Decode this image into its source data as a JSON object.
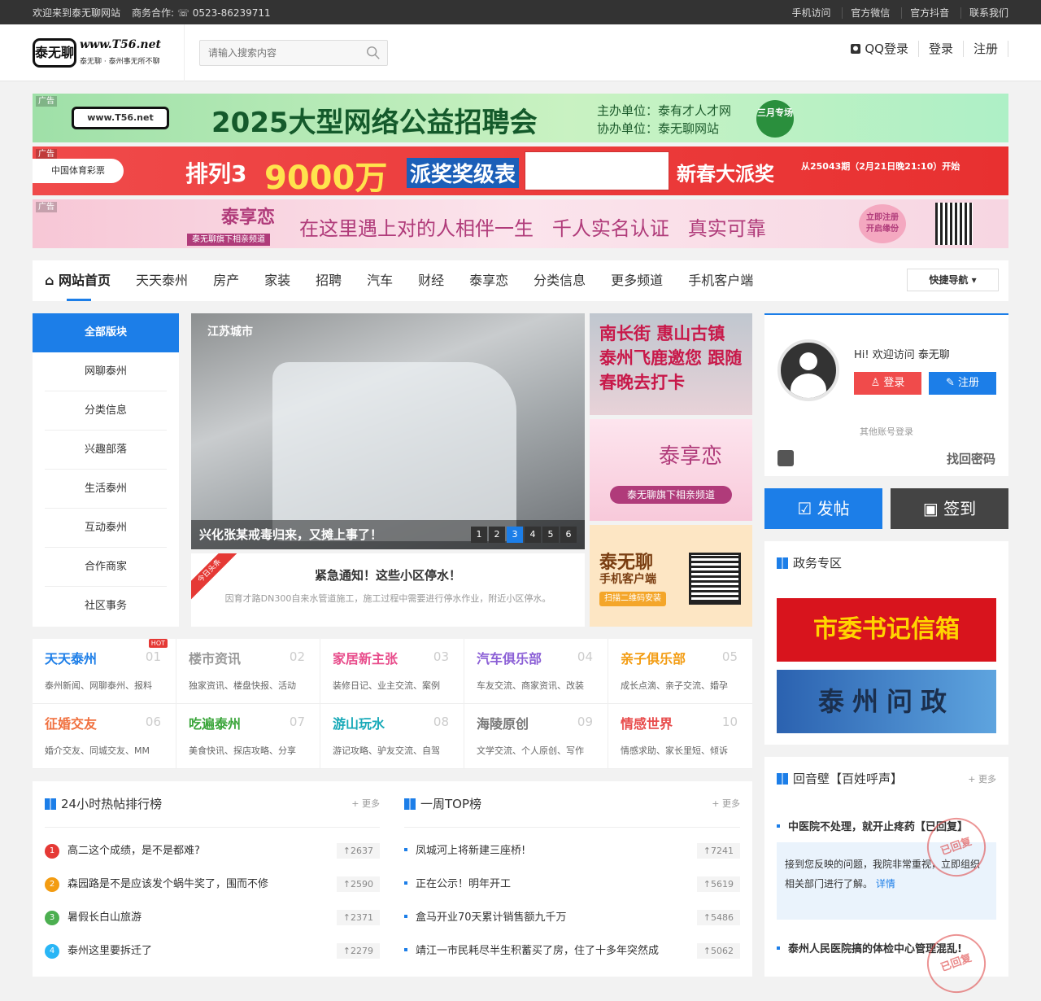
{
  "topbar": {
    "welcome": "欢迎来到泰无聊网站",
    "biz": "商务合作:",
    "phone": "0523-86239711",
    "links": [
      "手机访问",
      "官方微信",
      "官方抖音",
      "联系我们"
    ]
  },
  "logo": {
    "mark": "泰无聊",
    "url": "www.T56.net",
    "slogan": "泰无聊 · 泰州事无所不聊"
  },
  "search": {
    "placeholder": "请输入搜索内容"
  },
  "header": {
    "qq": "QQ登录",
    "login": "登录",
    "register": "注册"
  },
  "banners": {
    "ad": "广告",
    "b1_title": "2025大型网络公益招聘会",
    "b1_host": "主办单位：泰有才人才网",
    "b1_co": "协办单位：泰无聊网站",
    "b1_badge": "三月专场",
    "b2_brand": "中国体育彩票",
    "b2_game": "排列3",
    "b2_amount": "9000万",
    "b2_slogan": "派奖奖级表",
    "b2_right": "新春大派奖",
    "b2_note": "从25043期（2月21日晚21:10）开始",
    "b3_brand": "泰享恋",
    "b3_sub": "泰无聊旗下相亲频道",
    "b3_text": "在这里遇上对的人相伴一生   千人实名认证   真实可靠",
    "b3_btn": "立即注册开启缘份"
  },
  "nav": {
    "items": [
      "网站首页",
      "天天泰州",
      "房产",
      "家装",
      "招聘",
      "汽车",
      "财经",
      "泰享恋",
      "分类信息",
      "更多频道",
      "手机客户端"
    ],
    "quick": "快捷导航"
  },
  "side": {
    "head": "全部版块",
    "items": [
      "网聊泰州",
      "分类信息",
      "兴趣部落",
      "生活泰州",
      "互动泰州",
      "合作商家",
      "社区事务"
    ]
  },
  "slider": {
    "source": "江苏城市",
    "caption": "兴化张某戒毒归来，又摊上事了！",
    "pages": [
      "1",
      "2",
      "3",
      "4",
      "5",
      "6"
    ],
    "active": 2
  },
  "headline": {
    "ribbon": "今日头条",
    "title": "紧急通知！这些小区停水！",
    "desc": "因育才路DN300自来水管道施工，施工过程中需要进行停水作业，附近小区停水。"
  },
  "promos": {
    "p1": "南长街 惠山古镇 泰州飞鹿邀您 跟随春晚去打卡",
    "p2_title": "泰享恋",
    "p2_sub": "泰无聊旗下相亲频道",
    "p3_title": "泰无聊",
    "p3_sub": "手机客户端",
    "p3_btn": "扫描二维码安装"
  },
  "login": {
    "hi": "Hi! 欢迎访问 泰无聊",
    "login": "登录",
    "register": "注册",
    "other": "其他账号登录",
    "forgot": "找回密码"
  },
  "actions": {
    "post": "发帖",
    "sign": "签到"
  },
  "gov": {
    "title": "政务专区",
    "b1": "市委书记信箱",
    "b2": "泰州问政"
  },
  "cats": [
    {
      "name": "天天泰州",
      "no": "01",
      "desc": "泰州新闻、网聊泰州、报料",
      "color": "#1c7ee8",
      "hot": "HOT"
    },
    {
      "name": "楼市资讯",
      "no": "02",
      "desc": "独家资讯、楼盘快报、活动",
      "color": "#999"
    },
    {
      "name": "家居新主张",
      "no": "03",
      "desc": "装修日记、业主交流、案例",
      "color": "#e84c8b"
    },
    {
      "name": "汽车俱乐部",
      "no": "04",
      "desc": "车友交流、商家资讯、改装",
      "color": "#8b5fd6"
    },
    {
      "name": "亲子俱乐部",
      "no": "05",
      "desc": "成长点滴、亲子交流、婚孕",
      "color": "#f39c12"
    },
    {
      "name": "征婚交友",
      "no": "06",
      "desc": "婚介交友、同城交友、MM",
      "color": "#f0703f"
    },
    {
      "name": "吃遍泰州",
      "no": "07",
      "desc": "美食快讯、探店攻略、分享",
      "color": "#3aa53a"
    },
    {
      "name": "游山玩水",
      "no": "08",
      "desc": "游记攻略、驴友交流、自驾",
      "color": "#17a9b8"
    },
    {
      "name": "海陵原创",
      "no": "09",
      "desc": "文学交流、个人原创、写作",
      "color": "#777"
    },
    {
      "name": "情感世界",
      "no": "10",
      "desc": "情感求助、家长里短、倾诉",
      "color": "#e84c4c"
    }
  ],
  "hot24": {
    "title": "24小时热帖排行榜",
    "more": "+ 更多",
    "items": [
      {
        "rank": "1",
        "text": "高二这个成绩，是不是都难?",
        "count": "↑2637"
      },
      {
        "rank": "2",
        "text": "森园路是不是应该发个蜗牛奖了，围而不修",
        "count": "↑2590"
      },
      {
        "rank": "3",
        "text": "暑假长白山旅游",
        "count": "↑2371"
      },
      {
        "rank": "4",
        "text": "泰州这里要拆迁了",
        "count": "↑2279"
      }
    ]
  },
  "weekly": {
    "title": "一周TOP榜",
    "more": "+ 更多",
    "items": [
      {
        "text": "凤城河上将新建三座桥!",
        "count": "↑7241"
      },
      {
        "text": "正在公示！明年开工",
        "count": "↑5619"
      },
      {
        "text": "盒马开业70天累计销售额九千万",
        "count": "↑5486"
      },
      {
        "text": "靖江一市民耗尽半生积蓄买了房，住了十多年突然成",
        "count": "↑5062"
      }
    ]
  },
  "echo": {
    "title": "回音壁【百姓呼声】",
    "more": "+ 更多",
    "q1": "中医院不处理，就开止疼药【已回复】",
    "a1": "接到您反映的问题，我院非常重视，立即组织相关部门进行了解。",
    "detail": "详情",
    "stamp": "已回复",
    "q2": "泰州人民医院搞的体检中心管理混乱!"
  },
  "colors": {
    "accent": "#1c7ee8",
    "red": "#f04b4b",
    "dark": "#444"
  }
}
